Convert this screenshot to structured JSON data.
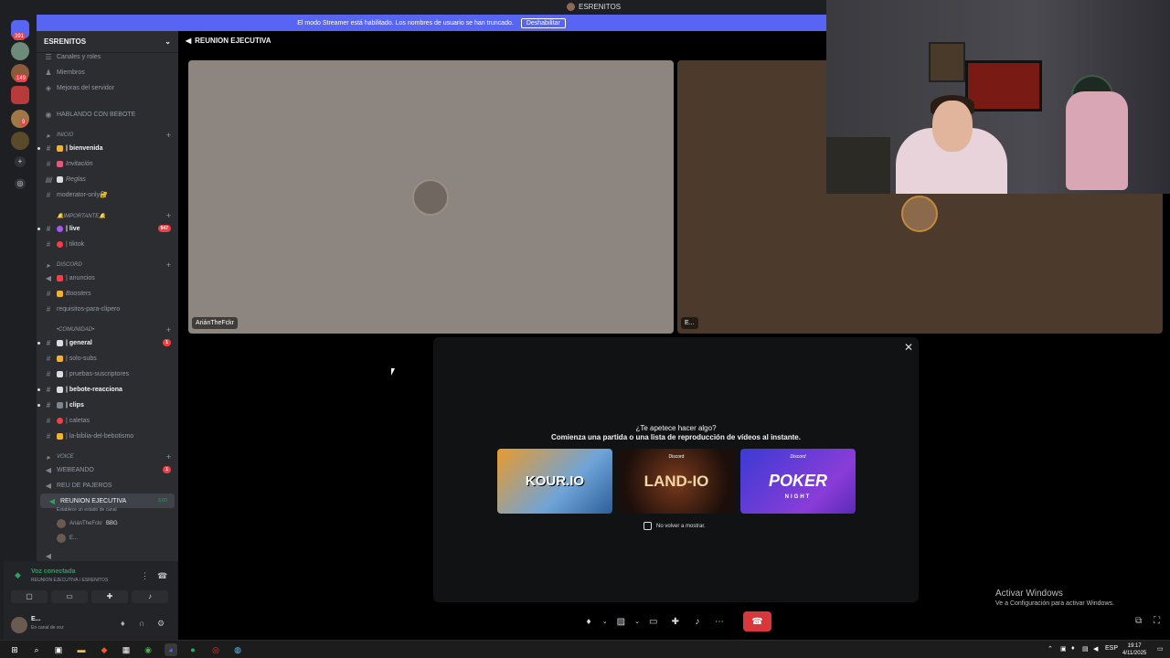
{
  "window": {
    "title": "ESRENITOS"
  },
  "banner": {
    "text": "El modo Streamer está habilitado. Los nombres de usuario se han truncado.",
    "button": "Deshabilitar"
  },
  "rail": {
    "badges": [
      "391",
      "149",
      "9"
    ]
  },
  "server": {
    "name": "ESRENITOS"
  },
  "sidebar": {
    "top_items": [
      "Canales y roles",
      "Miembros",
      "Mejoras del servidor"
    ],
    "hablando": "HABLANDO CON BEBOTE",
    "cat_inicio": "INICIO",
    "bienvenida": "| bienvenida",
    "invitacion": "Invitación",
    "reglas": "Reglas",
    "moderator": "moderator-only🔐",
    "cat_importante": "🔔IMPORTANTE🔔",
    "live": "| live",
    "live_count": "947",
    "tiktok": "| tiktok",
    "cat_discord": "DISCORD",
    "anuncios": "| anuncios",
    "boosters": "Boosters",
    "requisitos": "requisitos-para-clipero",
    "cat_comunidad": "•COMUNIDAD•",
    "general": "| general",
    "general_count": "1",
    "solo_subs": "| solo-subs",
    "pruebas": "| pruebas-suscriptores",
    "bebote": "| bebote-reacciona",
    "clips": "| clips",
    "caletas": "| caletas",
    "biblia": "| la-biblia-del-bebotismo",
    "cat_voice": "VOICE",
    "webeando": "WEBEANDO",
    "webeando_count": "1",
    "reu": "REU DE PAJEROS",
    "reunion": "REUNION EJECUTIVA",
    "reunion_time": "6:00",
    "reunion_status": "Establece un estado de canal",
    "member1": "AriánTheFckr",
    "member1_tag": "BBG",
    "member2": "E..."
  },
  "voice": {
    "status": "Voz conectada",
    "channel": "REUNION EJECUTIVA / ESRENITOS"
  },
  "user": {
    "name": "E...",
    "status": "En canal de voz"
  },
  "call": {
    "header": "REUNION EJECUTIVA",
    "tile1_name": "AriánTheFckr",
    "tile2_name": "E..."
  },
  "modal": {
    "title": "¿Te apetece hacer algo?",
    "subtitle": "Comienza una partida o una lista de reproducción de vídeos al instante.",
    "games": [
      "KOUR.IO",
      "LAND-IO",
      "POKER"
    ],
    "game_small": "Discord",
    "poker_sub": "NIGHT",
    "checkbox": "No volver a mostrar."
  },
  "watermark": {
    "line1": "Activar Windows",
    "line2": "Ve a Configuración para activar Windows."
  },
  "taskbar": {
    "lang": "ESP",
    "time": "19:17",
    "date": "4/11/2025"
  }
}
